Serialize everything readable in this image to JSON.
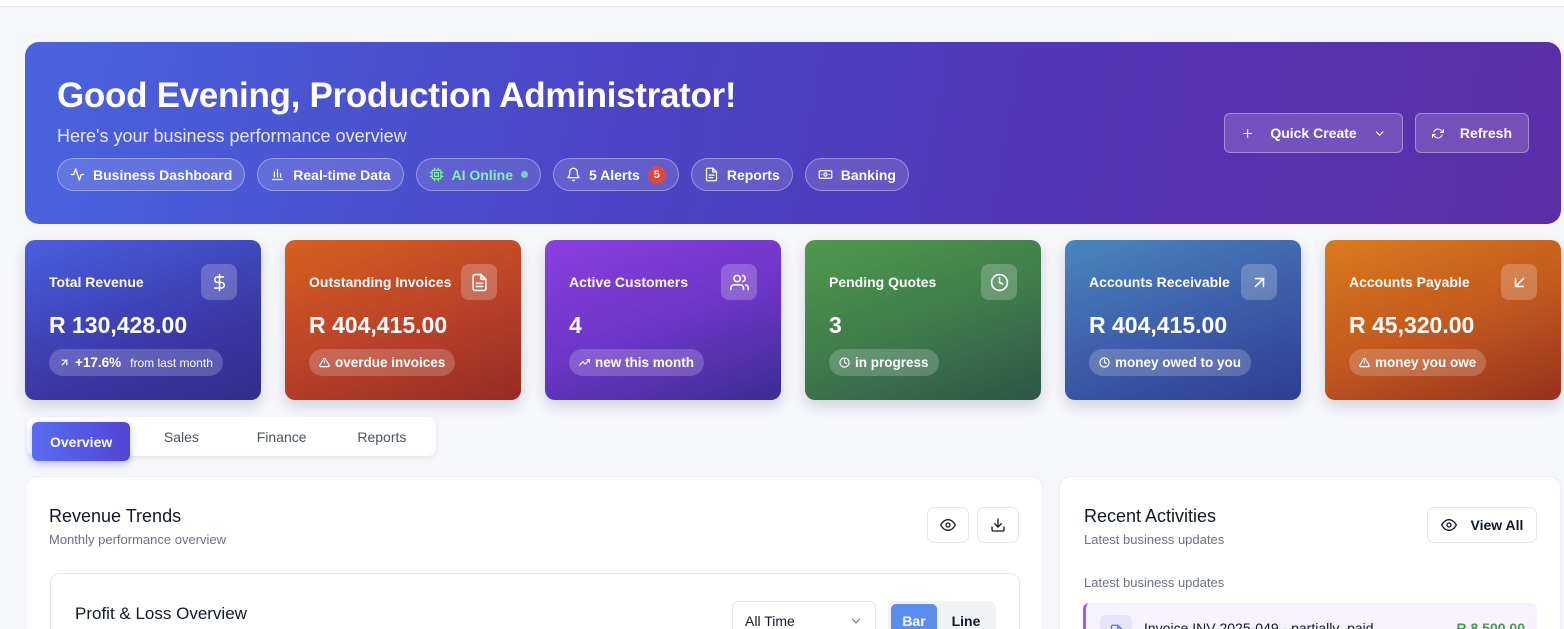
{
  "hero": {
    "greeting": "Good Evening, Production Administrator!",
    "subtitle": "Here's your business performance overview",
    "chips": [
      {
        "label": "Business Dashboard",
        "icon": "activity-icon"
      },
      {
        "label": "Real-time Data",
        "icon": "bar-chart-icon"
      },
      {
        "label": "AI Online",
        "icon": "cpu-icon",
        "color": "#86efac"
      },
      {
        "label": "5 Alerts",
        "icon": "bell-icon",
        "badge": "5"
      },
      {
        "label": "Reports",
        "icon": "file-icon"
      },
      {
        "label": "Banking",
        "icon": "banknote-icon"
      }
    ],
    "quick_create": "Quick Create",
    "refresh": "Refresh"
  },
  "kpis": [
    {
      "label": "Total Revenue",
      "value": "R 130,428.00",
      "pill": "+17.6%",
      "pill_suffix": "from last month",
      "icon": "dollar-icon",
      "color": "#4a5fe0"
    },
    {
      "label": "Outstanding Invoices",
      "value": "R 404,415.00",
      "pill": "overdue invoices",
      "icon": "file-text-icon",
      "color": "#c24a25"
    },
    {
      "label": "Active Customers",
      "value": "4",
      "pill": "new this month",
      "icon": "users-icon",
      "color": "#7a3ad6"
    },
    {
      "label": "Pending Quotes",
      "value": "3",
      "pill": "in progress",
      "icon": "clock-icon",
      "color": "#3f7d4b"
    },
    {
      "label": "Accounts Receivable",
      "value": "R 404,415.00",
      "pill": "money owed to you",
      "icon": "arrow-up-right-icon",
      "color": "#3d63ad"
    },
    {
      "label": "Accounts Payable",
      "value": "R 45,320.00",
      "pill": "money you owe",
      "icon": "arrow-down-left-icon",
      "color": "#c85a1f"
    }
  ],
  "tabs": [
    "Overview",
    "Sales",
    "Finance",
    "Reports"
  ],
  "revenue": {
    "title": "Revenue Trends",
    "subtitle": "Monthly performance overview",
    "pl_title": "Profit & Loss Overview",
    "period": "All Time",
    "toggle": [
      "Bar",
      "Line"
    ]
  },
  "activities": {
    "title": "Recent Activities",
    "subtitle": "Latest business updates",
    "view_all": "View All",
    "section_label": "Latest business updates",
    "item_text": "Invoice INV-2025-049 - partially_paid",
    "item_amount": "R 8 500.00"
  }
}
